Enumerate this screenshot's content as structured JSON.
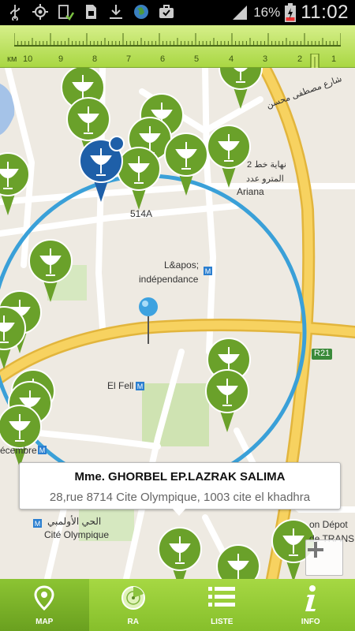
{
  "status_bar": {
    "battery_percent": "16%",
    "time": "11:02",
    "icons": [
      "usb-icon",
      "gps-icon",
      "download-done-icon",
      "sd-card-icon",
      "download-icon",
      "globe-icon",
      "briefcase-icon",
      "signal-icon",
      "battery-charging-icon"
    ]
  },
  "ruler": {
    "unit": "км",
    "ticks": [
      "10",
      "9",
      "8",
      "7",
      "6",
      "5",
      "4",
      "3",
      "2",
      "1"
    ],
    "selected_km": 1.8
  },
  "map": {
    "labels": {
      "street_arabic": "شارع مصطفى محسن",
      "ariana_arabic_1": "2 نهاية خط",
      "ariana_arabic_2": "المترو عدد",
      "ariana": "Ariana",
      "route_514a": "514A",
      "independance_1": "L&apos;",
      "independance_2": "indépendance",
      "r21": "R21",
      "el_fell": "El Fell",
      "decembre": "écembre",
      "cite_olympique_ar": "الحي الأولمبي",
      "cite_olympique": "Cité Olympique",
      "depot": "on Dépot",
      "transit": "de TRANSI"
    },
    "zoom_icon": "plus-icon"
  },
  "selected_pharmacy": {
    "name": "Mme. GHORBEL EP.LAZRAK SALIMA",
    "address": "28,rue 8714 Cite Olympique, 1003 cite el khadhra"
  },
  "colors": {
    "pin_green": "#6aa12a",
    "pin_blue": "#1e5fa8",
    "radius_circle": "#3aa0d8",
    "highway": "#f2c84b"
  },
  "nav": {
    "items": [
      {
        "label": "MAP",
        "icon": "map-pin-icon",
        "active": true
      },
      {
        "label": "RA",
        "icon": "radar-icon",
        "active": false
      },
      {
        "label": "LISTE",
        "icon": "list-icon",
        "active": false
      },
      {
        "label": "INFO",
        "icon": "info-icon",
        "active": false
      }
    ]
  }
}
